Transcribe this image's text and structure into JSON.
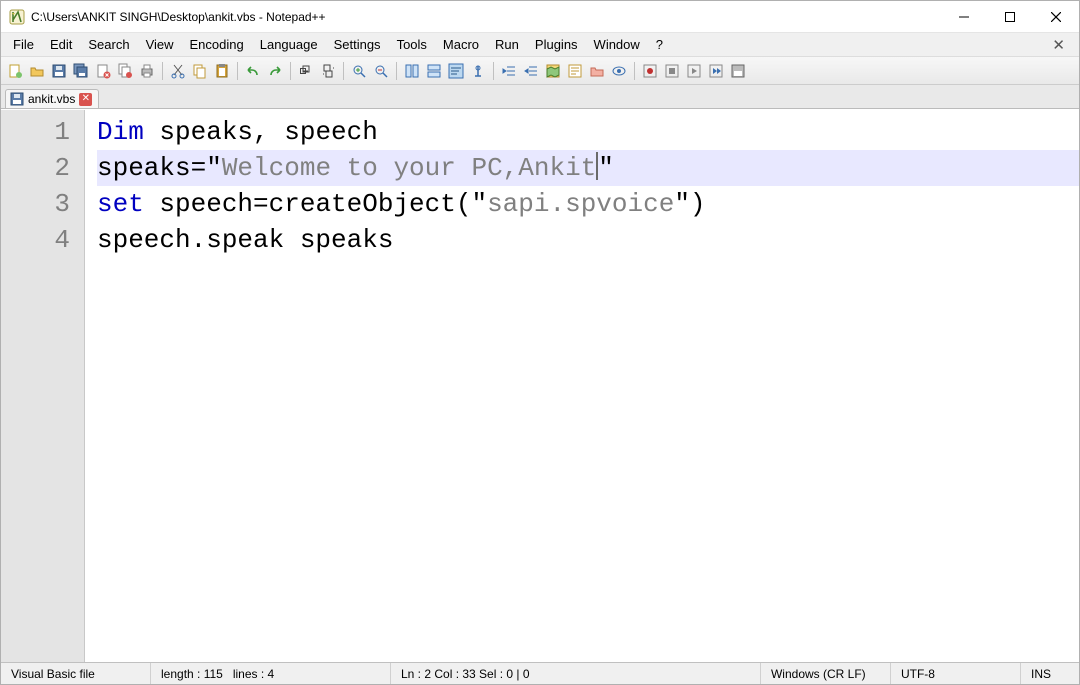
{
  "window": {
    "title": "C:\\Users\\ANKIT SINGH\\Desktop\\ankit.vbs - Notepad++"
  },
  "menu": {
    "items": [
      "File",
      "Edit",
      "Search",
      "View",
      "Encoding",
      "Language",
      "Settings",
      "Tools",
      "Macro",
      "Run",
      "Plugins",
      "Window",
      "?"
    ]
  },
  "tab": {
    "filename": "ankit.vbs"
  },
  "code": {
    "lines": [
      {
        "n": "1",
        "segments": [
          {
            "t": "Dim",
            "c": "kw"
          },
          {
            "t": " speaks, speech",
            "c": "def"
          }
        ]
      },
      {
        "n": "2",
        "selected": true,
        "segments": [
          {
            "t": "speaks=",
            "c": "def"
          },
          {
            "t": "\"",
            "c": "def"
          },
          {
            "t": "Welcome to your PC,Ankit",
            "c": "str"
          },
          {
            "t": "",
            "c": "caret"
          },
          {
            "t": "\"",
            "c": "def"
          }
        ]
      },
      {
        "n": "3",
        "segments": [
          {
            "t": "set",
            "c": "kw"
          },
          {
            "t": " speech=createObject(",
            "c": "def"
          },
          {
            "t": "\"",
            "c": "def"
          },
          {
            "t": "sapi.spvoice",
            "c": "str"
          },
          {
            "t": "\"",
            "c": "def"
          },
          {
            "t": ")",
            "c": "def"
          }
        ]
      },
      {
        "n": "4",
        "segments": [
          {
            "t": "speech.speak speaks",
            "c": "def"
          }
        ]
      }
    ]
  },
  "status": {
    "filetype": "Visual Basic file",
    "length_label": "length : 115",
    "lines_label": "lines : 4",
    "pos_label": "Ln : 2    Col : 33    Sel : 0 | 0",
    "eol": "Windows (CR LF)",
    "encoding": "UTF-8",
    "mode": "INS"
  }
}
